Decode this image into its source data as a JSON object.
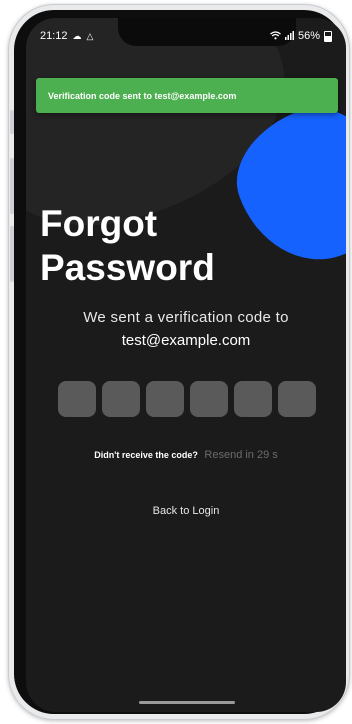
{
  "status_bar": {
    "time": "21:12",
    "left_icons": [
      "cloud-icon",
      "warning-triangle-icon"
    ],
    "right_icons": [
      "wifi-icon",
      "signal-icon",
      "battery-icon"
    ],
    "battery": "56%"
  },
  "toast": {
    "message": "Verification code sent to test@example.com",
    "color": "#4caf50"
  },
  "header": {
    "title_line1": "Forgot",
    "title_line2": "Password"
  },
  "verification": {
    "subtitle": "We sent a verification code to",
    "email": "test@example.com",
    "code_length": 6
  },
  "resend": {
    "label": "Didn't receive the code?",
    "timer_text": "Resend in 29 s"
  },
  "actions": {
    "back_label": "Back to Login"
  },
  "colors": {
    "background": "#1b1b1b",
    "accent_blue": "#1662ff",
    "code_box": "#5a5a5a"
  }
}
